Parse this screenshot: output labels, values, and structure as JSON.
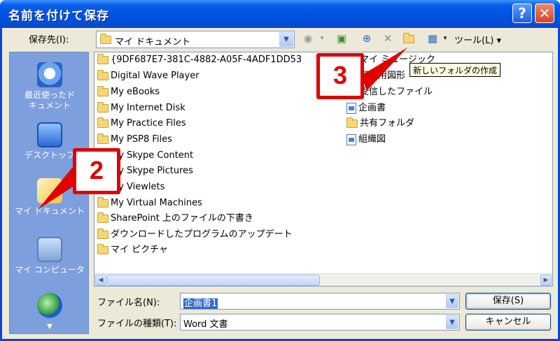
{
  "window": {
    "title": "名前を付けて保存",
    "help_label": "?",
    "close_label": "✕"
  },
  "save_in": {
    "label": "保存先(I):",
    "value": "マイ ドキュメント"
  },
  "toolbar": {
    "tools_label": "ツール(L)"
  },
  "places": [
    {
      "label": "最近使ったド\nキュメント",
      "icon": "recent-documents-icon"
    },
    {
      "label": "デスクトップ",
      "icon": "desktop-icon"
    },
    {
      "label": "マイ ドキュメント",
      "icon": "my-documents-icon"
    },
    {
      "label": "マイ コンピュータ",
      "icon": "my-computer-icon"
    },
    {
      "label": "",
      "icon": "network-icon"
    }
  ],
  "files_left": [
    "{9DF687E7-381C-4882-A05F-4ADF1DD53",
    "Digital Wave Player",
    "My eBooks",
    "My Internet Disk",
    "My Practice Files",
    "My PSP8 Files",
    "My Skype Content",
    "My Skype Pictures",
    "My Viewlets",
    "My Virtual Machines",
    "SharePoint 上のファイルの下書き",
    "ダウンロードしたプログラムのアップデート",
    "マイ ピクチャ"
  ],
  "files_right": [
    "マイ ミュージック",
    "個人用図形",
    "受信したファイル",
    "企画書",
    "共有フォルダ",
    "組織図"
  ],
  "tooltip": "新しいフォルダの作成",
  "filename": {
    "label": "ファイル名(N):",
    "value": "企画書1"
  },
  "filetype": {
    "label": "ファイルの種類(T):",
    "value": "Word 文書"
  },
  "buttons": {
    "save": "保存(S)",
    "cancel": "キャンセル"
  },
  "callouts": {
    "two": "2",
    "three": "3"
  },
  "colors": {
    "titlebar": "#0054e3",
    "places_bar": "#7d9fdd",
    "callout": "#e00000",
    "selection": "#316ac5"
  }
}
